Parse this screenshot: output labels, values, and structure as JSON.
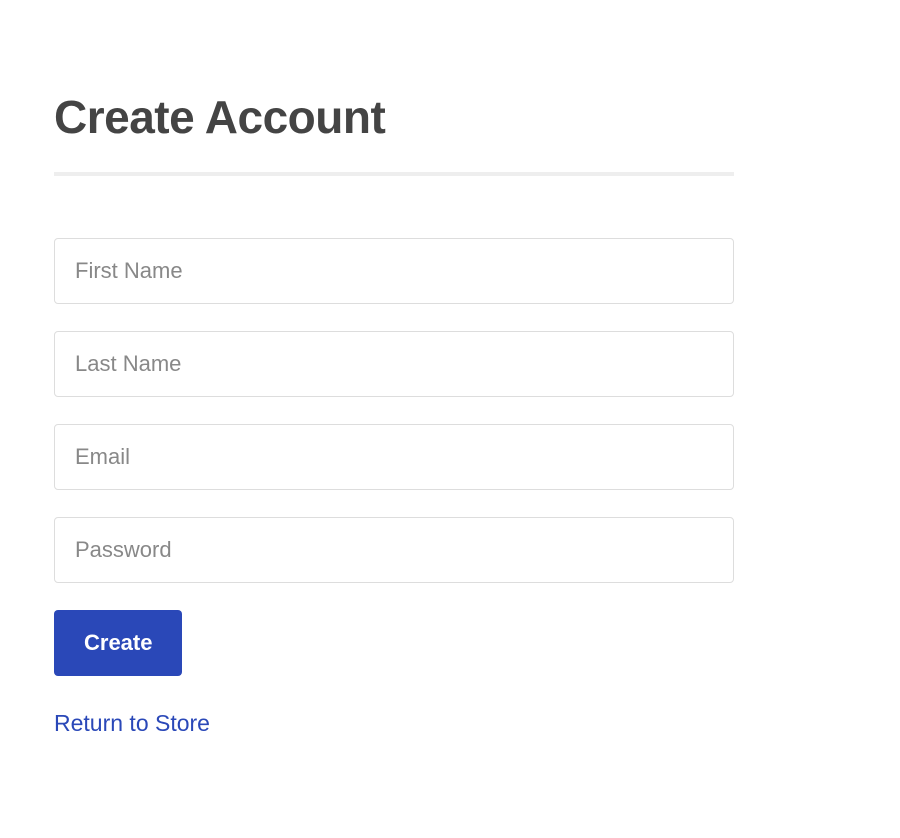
{
  "page": {
    "title": "Create Account"
  },
  "form": {
    "firstName": {
      "placeholder": "First Name",
      "value": ""
    },
    "lastName": {
      "placeholder": "Last Name",
      "value": ""
    },
    "email": {
      "placeholder": "Email",
      "value": ""
    },
    "password": {
      "placeholder": "Password",
      "value": ""
    },
    "submitLabel": "Create"
  },
  "links": {
    "returnToStore": "Return to Store"
  }
}
